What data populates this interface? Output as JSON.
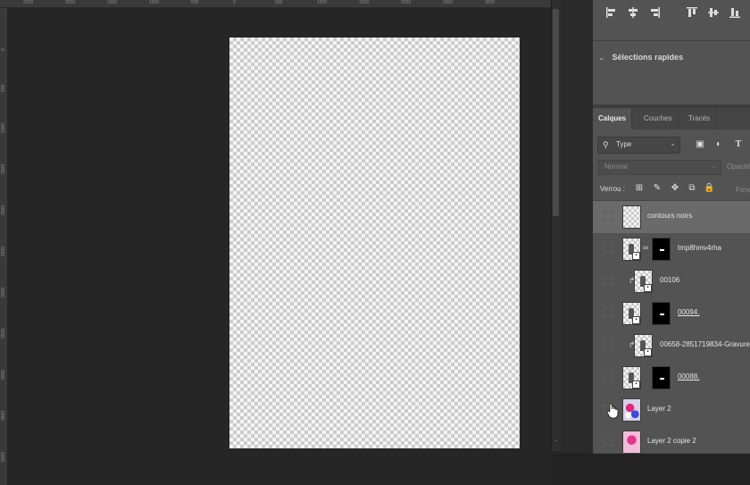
{
  "ruler": {
    "top_ticks": [
      "2500",
      "2000",
      "1500",
      "1000",
      "500",
      "0",
      "500",
      "1000",
      "1500",
      "2000",
      "2500",
      "3000"
    ],
    "left_ticks": [
      "0",
      "500",
      "1000",
      "1500",
      "2000",
      "2500",
      "3000",
      "3500",
      "4000",
      "4500",
      "5000"
    ]
  },
  "panel": {
    "quick_selections": "Sélections rapides",
    "tabs": [
      {
        "label": "Calques",
        "active": true
      },
      {
        "label": "Couches",
        "active": false
      },
      {
        "label": "Tracés",
        "active": false
      }
    ],
    "filter": {
      "label": "Type"
    },
    "blend_mode": "Normal",
    "opacity_label": "Opacité",
    "lock_label": "Verrou :",
    "fill_label": "Fond"
  },
  "layers": [
    {
      "name": "contours noirs",
      "selected": true,
      "mask": false,
      "linked": false,
      "clipped": false,
      "underlined": false,
      "visible": false
    },
    {
      "name": "tmp8hmv4rha",
      "selected": false,
      "mask": true,
      "linked": true,
      "clipped": false,
      "underlined": false,
      "visible": false
    },
    {
      "name": "00106",
      "selected": false,
      "mask": false,
      "linked": false,
      "clipped": true,
      "underlined": false,
      "visible": false
    },
    {
      "name": "00094.",
      "selected": false,
      "mask": true,
      "linked": false,
      "clipped": false,
      "underlined": true,
      "visible": false
    },
    {
      "name": "00658-2851719834-Gravure",
      "selected": false,
      "mask": false,
      "linked": false,
      "clipped": true,
      "underlined": false,
      "visible": false
    },
    {
      "name": "00088.",
      "selected": false,
      "mask": true,
      "linked": false,
      "clipped": false,
      "underlined": true,
      "visible": false
    },
    {
      "name": "Layer 2",
      "selected": false,
      "mask": false,
      "linked": false,
      "clipped": false,
      "underlined": false,
      "visible": false
    },
    {
      "name": "Layer 2 copie 2",
      "selected": false,
      "mask": false,
      "linked": false,
      "clipped": false,
      "underlined": false,
      "visible": false
    }
  ],
  "colors": {
    "panel": "#535353",
    "workspace": "#262626",
    "selected_layer": "#6a6a6a"
  }
}
